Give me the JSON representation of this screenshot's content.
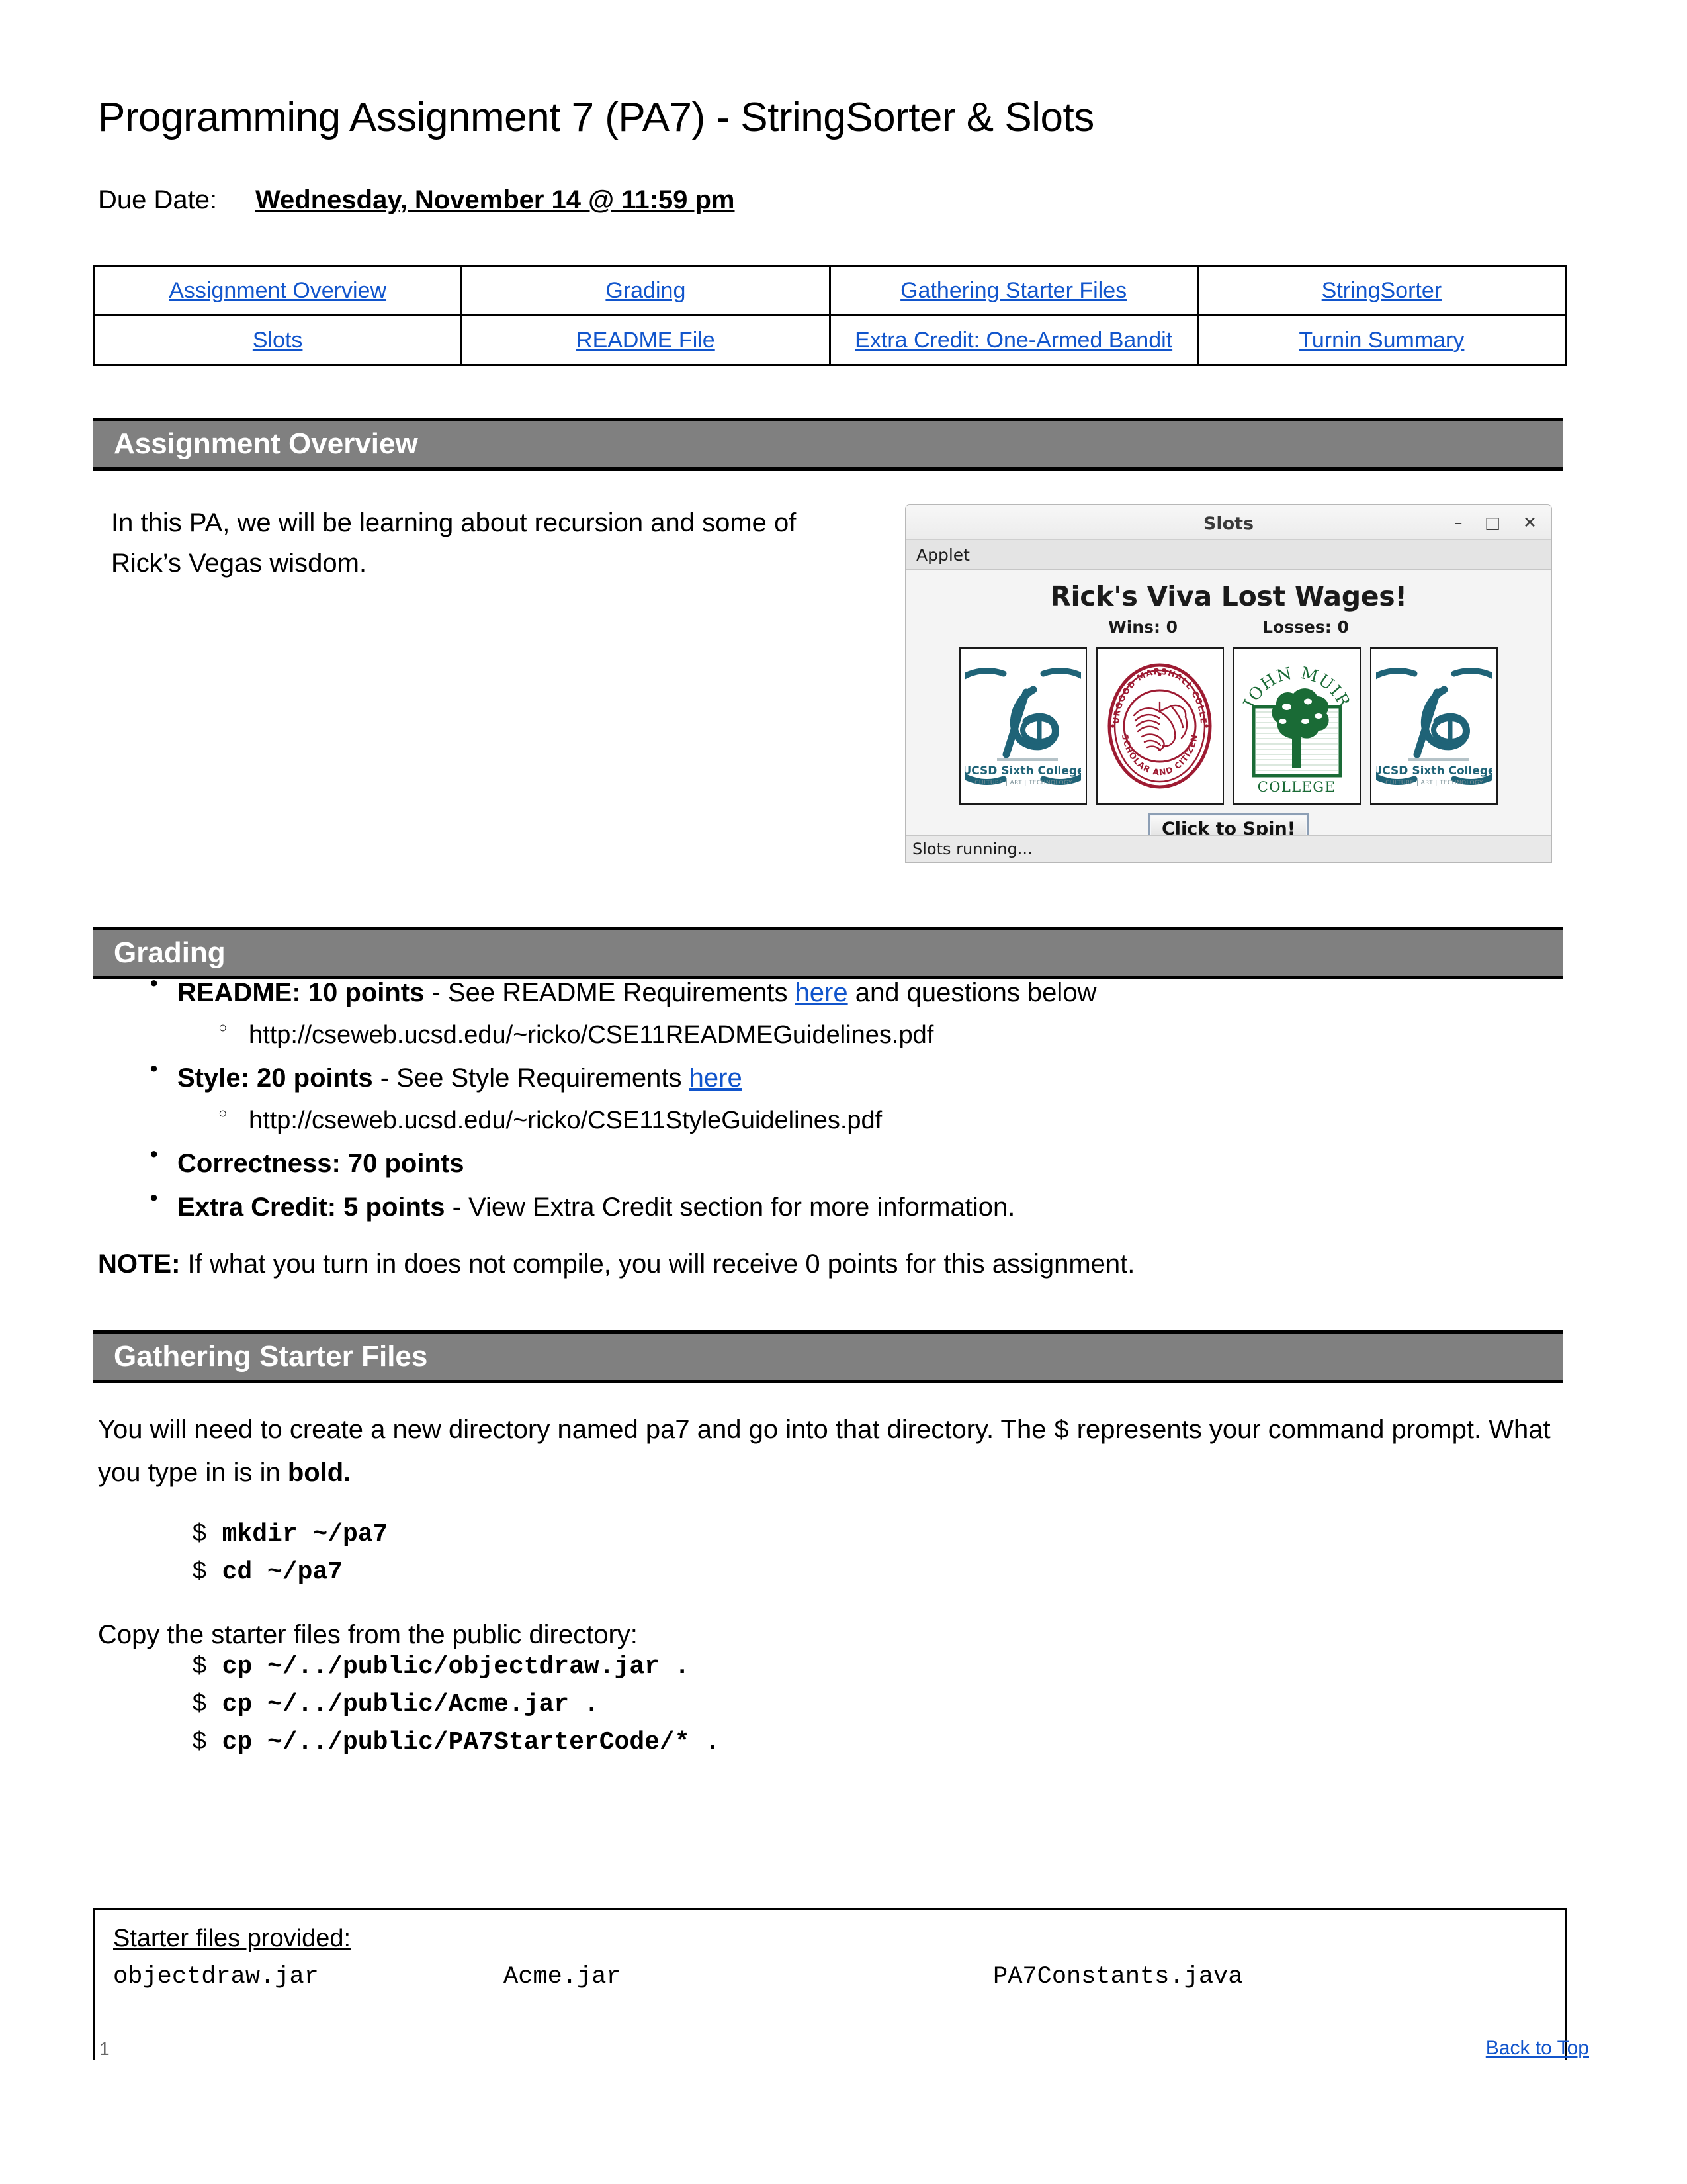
{
  "document": {
    "title": "Programming Assignment 7 (PA7) - StringSorter & Slots",
    "due_label": "Due Date:",
    "due_value": "Wednesday, November 14 @ 11:59 pm"
  },
  "nav": {
    "row1": [
      {
        "label": "Assignment Overview"
      },
      {
        "label": "Grading"
      },
      {
        "label": "Gathering Starter Files"
      },
      {
        "label": "StringSorter"
      }
    ],
    "row2": [
      {
        "label": "Slots"
      },
      {
        "label": "README File"
      },
      {
        "label": "Extra Credit: One-Armed Bandit"
      },
      {
        "label": "Turnin Summary"
      }
    ]
  },
  "sections": {
    "overview": {
      "heading": "Assignment Overview",
      "paragraph": "In this PA, we will be learning about recursion and some of Rick’s Vegas wisdom."
    },
    "grading": {
      "heading": "Grading",
      "bullets": [
        {
          "bold": "README: 10 points",
          "rest_before_link": " - See README Requirements ",
          "link": "here",
          "rest_after_link": " and questions below",
          "sub": "http://cseweb.ucsd.edu/~ricko/CSE11READMEGuidelines.pdf"
        },
        {
          "bold": "Style: 20 points",
          "rest_before_link": " - See Style Requirements ",
          "link": "here",
          "rest_after_link": "",
          "sub": "http://cseweb.ucsd.edu/~ricko/CSE11StyleGuidelines.pdf"
        },
        {
          "bold": "Correctness: 70 points",
          "rest_before_link": "",
          "link": "",
          "rest_after_link": "",
          "sub": ""
        },
        {
          "bold": "Extra Credit: 5 points",
          "rest_before_link": " - View Extra Credit section for more information.",
          "link": "",
          "rest_after_link": "",
          "sub": ""
        }
      ],
      "note_bold": "NOTE:",
      "note_rest": " If what you turn in does not compile, you will receive 0 points for this assignment."
    },
    "gathering": {
      "heading": "Gathering Starter Files",
      "paragraph1_a": "You will need to create a new directory named pa7 and go into that directory. The ",
      "paragraph1_dollar": "$",
      "paragraph1_b": " represents your command prompt. What you type in is in ",
      "paragraph1_bold": "bold.",
      "commands1": [
        {
          "prompt": "$",
          "typed": "mkdir ~/pa7"
        },
        {
          "prompt": "$",
          "typed": "cd ~/pa7"
        }
      ],
      "paragraph2": "Copy the starter files from the public directory:",
      "commands2": [
        {
          "prompt": "$",
          "typed": "cp ~/../public/objectdraw.jar ."
        },
        {
          "prompt": "$",
          "typed": "cp ~/../public/Acme.jar ."
        },
        {
          "prompt": "$",
          "typed": "cp ~/../public/PA7StarterCode/* ."
        }
      ]
    }
  },
  "starter_box": {
    "title": "Starter files provided:",
    "files": [
      "objectdraw.jar",
      "Acme.jar",
      "PA7Constants.java"
    ]
  },
  "applet": {
    "window_title": "Slots",
    "minimize": "–",
    "maximize": "□",
    "close": "✕",
    "menu_item": "Applet",
    "heading": "Rick's Viva Lost Wages!",
    "wins": "Wins: 0",
    "losses": "Losses: 0",
    "reels": [
      {
        "name": "UCSD Sixth College",
        "tagline": "CULTURE | ART | TECHNOLOGY",
        "color": "#1f6377"
      },
      {
        "name": "Thurgood Marshall College",
        "tagline": "SCHOLAR AND CITIZEN",
        "color": "#9e1b32"
      },
      {
        "name": "John Muir College",
        "tagline": "COLLEGE",
        "color": "#1a6b36"
      },
      {
        "name": "UCSD Sixth College",
        "tagline": "CULTURE | ART | TECHNOLOGY",
        "color": "#1f6377"
      }
    ],
    "spin_button": "Click to Spin!",
    "status": "Slots running..."
  },
  "footer": {
    "page_number": "1",
    "back_to_top": "Back to Top"
  },
  "colors": {
    "link": "#1155cc",
    "section_bar": "#808080",
    "sixth_teal": "#1f6377",
    "marshall_red": "#9e1b32",
    "muir_green": "#1a6b36"
  }
}
